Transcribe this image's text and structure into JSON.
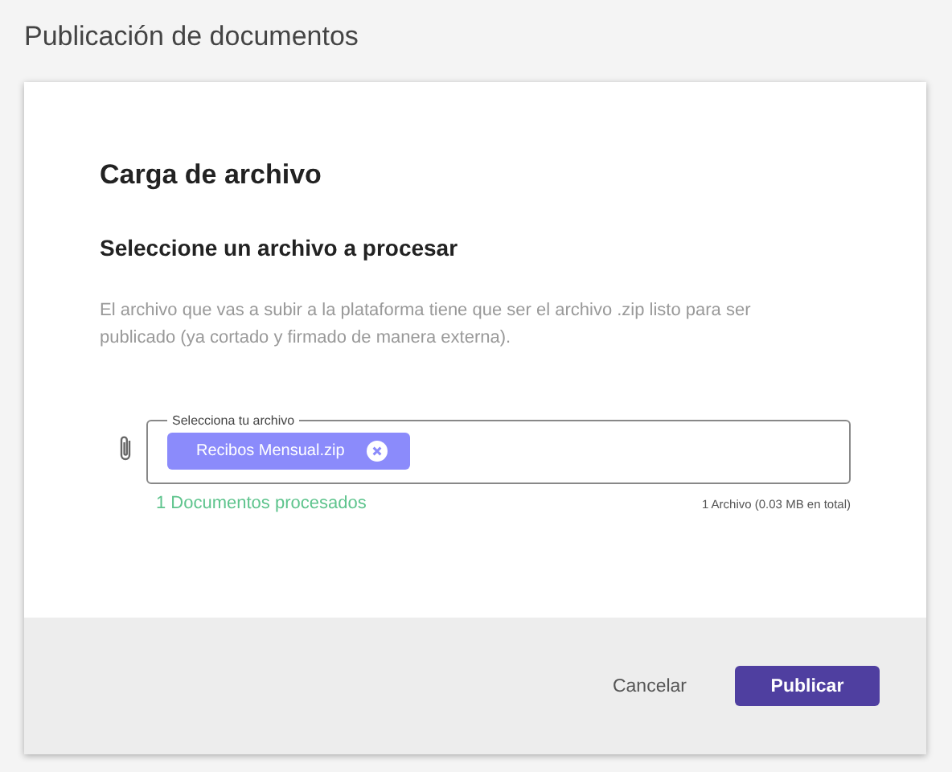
{
  "page_title": "Publicación de documentos",
  "card": {
    "title": "Carga de archivo",
    "subtitle": "Seleccione un archivo a procesar",
    "description": "El archivo que vas a subir a la plataforma tiene que ser el archivo .zip listo para ser publicado (ya cortado y firmado de manera externa).",
    "file_field": {
      "label": "Selecciona tu archivo",
      "files": [
        {
          "name": "Recibos Mensual.zip"
        }
      ]
    },
    "processed": "1 Documentos procesados",
    "summary": "1 Archivo (0.03 MB en total)"
  },
  "buttons": [
    {
      "label": "Cancelar",
      "kind": "text"
    },
    {
      "label": "Publicar",
      "kind": "primary"
    }
  ]
}
